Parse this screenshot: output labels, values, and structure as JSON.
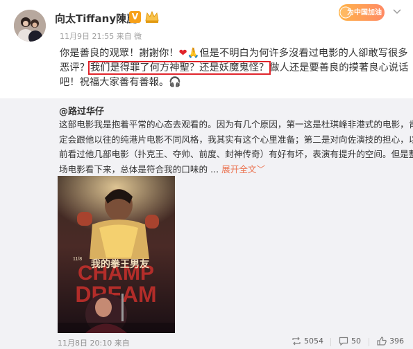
{
  "post": {
    "username": "向太Tiffany陳嵐",
    "vip_label": "V",
    "meta": "11月9日 21:55 来自 微",
    "text_lines": [
      {
        "before": "你是善良的观眾！謝謝你！",
        "heart": "❤",
        "mid": "🙏但是不明白为何许多沒看过电影的人卻敢写很多"
      },
      {
        "start": "恶评？",
        "highlight": "我们是得罪了何方神聖？还是妖魔鬼怪？",
        "end": "做人还是要善良的摸著良心说话"
      },
      {
        "text": "吧！祝福大家善有善報。🎧"
      }
    ]
  },
  "corner_badge": {
    "text": "为中国加油"
  },
  "quote": {
    "author": "@路过华仔",
    "lines": [
      "这部电影我是抱着平常的心态去观看的。因为有几个原因，第一这是杜琪峰非港式的电影，肯",
      "定会跟他以往的纯港片电影不同风格，我其实有这个心里准备；第二是对向佐演技的担心，以",
      "前看过他几部电影（扑克王、夺帅、前度、封神传奇）有好有坏，表演有提升的空间。但是整",
      "场电影看下来，总体是符合我的口味的 ..."
    ],
    "expand_label": "展开全文",
    "expand_arrow": "﹀",
    "poster": {
      "title": "我的拳王男友",
      "date": "11/8",
      "big_text_top": "CHAMP",
      "big_text_bottom": "DREAM"
    },
    "time": "11月8日 20:10 来自",
    "reposts": "5054",
    "comments": "50",
    "likes": "396"
  },
  "colors": {
    "highlight_border": "#e0242b",
    "expand_link": "#eb7350",
    "quote_bg": "#f2f2f5"
  }
}
